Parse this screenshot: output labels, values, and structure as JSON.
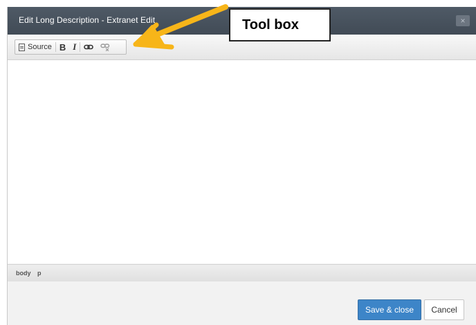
{
  "dialog": {
    "title": "Edit Long Description - Extranet Edit",
    "close_label": "×"
  },
  "toolbar": {
    "source_label": "Source",
    "bold_label": "B",
    "italic_label": "I",
    "link_icon": "link-icon",
    "unlink_icon": "unlink-icon"
  },
  "editor": {
    "content": ""
  },
  "pathbar": {
    "items": [
      "body",
      "p"
    ]
  },
  "footer": {
    "save_label": "Save & close",
    "cancel_label": "Cancel"
  },
  "annotation": {
    "callout_text": "Tool box",
    "arrow_color": "#f7b519"
  },
  "colors": {
    "titlebar": "#47515c",
    "primary_button": "#3d85c8"
  }
}
